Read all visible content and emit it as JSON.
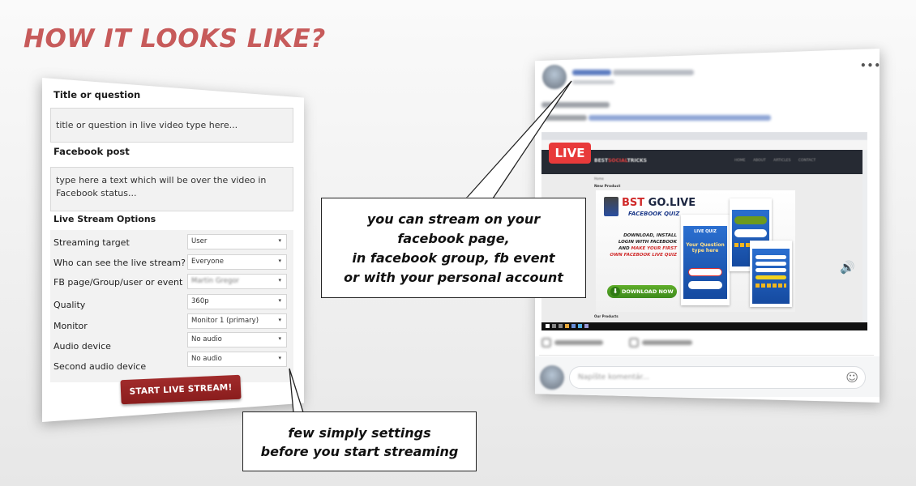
{
  "headline": "HOW IT LOOKS LIKE?",
  "settings_panel": {
    "title_label": "Title or question",
    "title_placeholder": "title or question in live video type here...",
    "post_label": "Facebook post",
    "post_placeholder": "type here a text which will be over the video in Facebook status...",
    "options_heading": "Live Stream Options",
    "options": [
      {
        "label": "Streaming target",
        "value": "User"
      },
      {
        "label": "Who can see the live stream?",
        "value": "Everyone"
      },
      {
        "label": "FB page/Group/user or event",
        "value": "Martin Gregor"
      },
      {
        "label": "Quality",
        "value": "360p"
      },
      {
        "label": "Monitor",
        "value": "Monitor 1 (primary)"
      },
      {
        "label": "Audio device",
        "value": "No audio"
      },
      {
        "label": "Second audio device",
        "value": "No audio"
      }
    ],
    "dropdown_icon": "▾",
    "start_button": "START LIVE STREAM!"
  },
  "callouts": {
    "stream_targets": [
      "you can stream on your",
      "facebook page,",
      "in facebook group, fb event",
      "or with your personal account"
    ],
    "settings": [
      "few simply settings",
      "before you start streaming"
    ]
  },
  "fb_post": {
    "more_icon": "•••",
    "live_badge": "LIVE",
    "site": {
      "logo_a": "BEST",
      "logo_b": "SOCIAL",
      "logo_c": "TRICKS",
      "nav": "HOME ABOUT ARTICLES CONTACT",
      "breadcrumb": "Home",
      "new_product": "New Product",
      "products_heading": "Our Products"
    },
    "promo": {
      "title_a": "BST",
      "title_b": " GO.LIVE",
      "subtitle": "FACEBOOK QUIZ",
      "step1": "DOWNLOAD, INSTALL",
      "step2": "LOGIN WITH FACEBOOK",
      "step3a": "AND ",
      "step3b": "MAKE YOUR FIRST",
      "step4": "OWN FACEBOOK LIVE QUIZ",
      "download": "DOWNLOAD NOW",
      "download_icon": "⬇",
      "quiz_label": "LIVE QUIZ",
      "quiz_question": "Your Question type here"
    },
    "volume_icon": "🔊",
    "comment_placeholder": "Napíšte komentár...",
    "emoji_icon": "☺"
  },
  "colors": {
    "headline": "#c75b5b",
    "start_button": "#961f1f",
    "live_badge": "#e83a3a",
    "download_button": "#4c9c22"
  }
}
